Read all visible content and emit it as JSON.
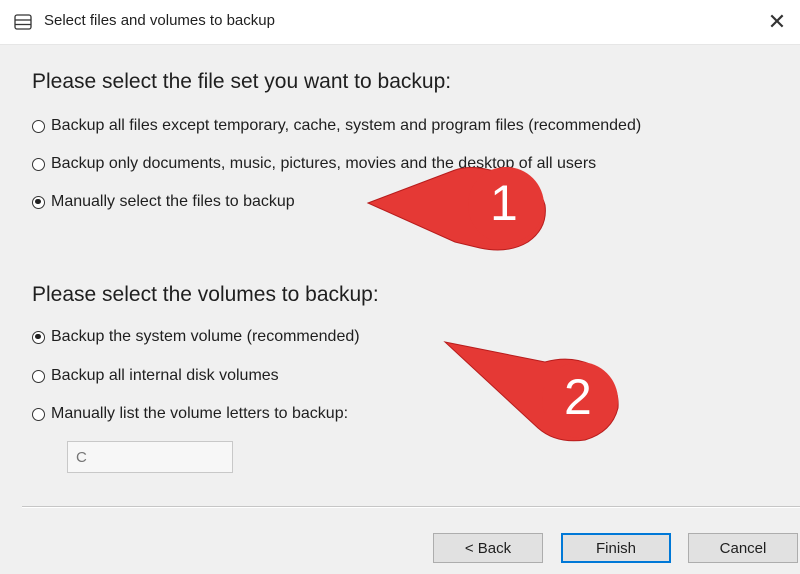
{
  "window": {
    "title": "Select files and volumes to backup",
    "close_glyph": "✕",
    "icon": "database-icon"
  },
  "file_set": {
    "heading": "Please select the file set you want to backup:",
    "options": [
      {
        "label": "Backup all files except temporary, cache, system and program files (recommended)",
        "selected": false
      },
      {
        "label": "Backup only documents, music, pictures, movies and the desktop of all users",
        "selected": false
      },
      {
        "label": "Manually select the files to backup",
        "selected": true
      }
    ]
  },
  "volumes": {
    "heading": "Please select the volumes to backup:",
    "options": [
      {
        "label": "Backup the system volume (recommended)",
        "selected": true
      },
      {
        "label": "Backup all internal disk volumes",
        "selected": false
      },
      {
        "label": "Manually list the volume letters to backup:",
        "selected": false
      }
    ],
    "letters_placeholder": "C"
  },
  "buttons": {
    "back": "< Back",
    "finish": "Finish",
    "cancel": "Cancel"
  },
  "annotations": [
    {
      "number": "1",
      "color": "#e53935"
    },
    {
      "number": "2",
      "color": "#e53935"
    }
  ]
}
